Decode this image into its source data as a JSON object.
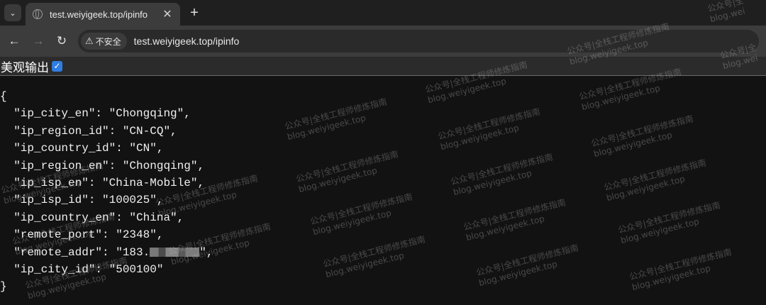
{
  "browser": {
    "tab_title": "test.weiyigeek.top/ipinfo",
    "close_glyph": "✕",
    "new_tab_glyph": "+",
    "dropdown_glyph": "⌄",
    "back_glyph": "←",
    "forward_glyph": "→",
    "reload_glyph": "↻",
    "security_label": "不安全",
    "warn_glyph": "⚠",
    "url": "test.weiyigeek.top/ipinfo"
  },
  "controls": {
    "pretty_label": "美观输出",
    "pretty_checked": true,
    "check_glyph": "✓"
  },
  "json_lines": {
    "open": "{",
    "l1": "  \"ip_city_en\": \"Chongqing\",",
    "l2": "  \"ip_region_id\": \"CN-CQ\",",
    "l3": "  \"ip_country_id\": \"CN\",",
    "l4": "  \"ip_region_en\": \"Chongqing\",",
    "l5": "  \"ip_isp_en\": \"China-Mobile\",",
    "l6": "  \"ip_isp_id\": \"100025\",",
    "l7": "  \"ip_country_en\": \"China\",",
    "l8": "  \"remote_port\": \"2348\",",
    "l9_prefix": "  \"remote_addr\": \"183.",
    "l9_suffix": "\",",
    "l10": "  \"ip_city_id\": \"500100\"",
    "close": "}"
  },
  "watermark": {
    "line1": "公众号|全栈工程师修炼指南",
    "line2": "blog.weiyigeek.top",
    "partial1": "公众号|全",
    "partial2": "blog.wei"
  }
}
